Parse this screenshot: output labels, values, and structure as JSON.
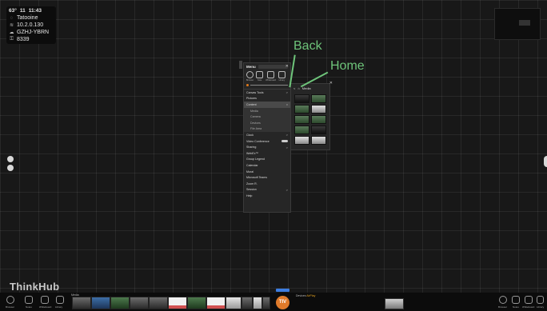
{
  "status": {
    "temperature": "63°",
    "date": "11",
    "time": "11:43",
    "location": "Tatooine",
    "ip": "10.2.0.130",
    "code": "GZHJ-YBRN",
    "pin": "8339"
  },
  "menu": {
    "title": "Menu",
    "icons": [
      {
        "name": "browser",
        "label": "Browser"
      },
      {
        "name": "note",
        "label": "Note"
      },
      {
        "name": "whiteboard",
        "label": "Whiteboard"
      },
      {
        "name": "library",
        "label": "Library"
      }
    ],
    "items": [
      {
        "label": "Canvas Tools",
        "chev": ">",
        "kind": "normal"
      },
      {
        "label": "Pictures",
        "chev": "",
        "kind": "normal"
      },
      {
        "label": "Content",
        "chev": "v",
        "kind": "selected"
      },
      {
        "label": "Media",
        "chev": "",
        "kind": "sub"
      },
      {
        "label": "Camera",
        "chev": "",
        "kind": "sub"
      },
      {
        "label": "Devices",
        "chev": "",
        "kind": "sub"
      },
      {
        "label": "File Area",
        "chev": "",
        "kind": "sub"
      },
      {
        "label": "Clock",
        "chev": ">",
        "kind": "normal"
      },
      {
        "label": "Video Conference",
        "chev": "toggle",
        "kind": "normal"
      },
      {
        "label": "Sharing",
        "chev": ">",
        "kind": "normal"
      },
      {
        "label": "WebEx™",
        "chev": "",
        "kind": "normal"
      },
      {
        "label": "Group Legend",
        "chev": "",
        "kind": "normal"
      },
      {
        "label": "Calendar",
        "chev": "",
        "kind": "normal"
      },
      {
        "label": "Mural",
        "chev": "",
        "kind": "normal"
      },
      {
        "label": "Microsoft Teams",
        "chev": "",
        "kind": "normal"
      },
      {
        "label": "Zoom R.",
        "chev": "",
        "kind": "normal"
      },
      {
        "label": "Session",
        "chev": ">",
        "kind": "normal"
      },
      {
        "label": "Help",
        "chev": "",
        "kind": "normal"
      }
    ]
  },
  "content_panel": {
    "title": "Media",
    "back": "<",
    "home": "⌂"
  },
  "annotations": {
    "back": "Back",
    "home": "Home"
  },
  "brand": "ThinkHub",
  "bottom": {
    "media_label": "Media",
    "tiv": "TIV",
    "devices_label": "Devices",
    "devices_badge": "AirPlay",
    "left_icons": [
      {
        "name": "browser",
        "label": "Browser"
      },
      {
        "name": "notes",
        "label": "Notes"
      },
      {
        "name": "whiteboard",
        "label": "Whiteboard"
      },
      {
        "name": "library",
        "label": "Library"
      }
    ],
    "right_icons": [
      {
        "name": "browser",
        "label": "Browser"
      },
      {
        "name": "notes",
        "label": "Notes"
      },
      {
        "name": "whiteboard",
        "label": "Whiteboard"
      },
      {
        "name": "library",
        "label": "Library"
      }
    ]
  },
  "colors": {
    "accent": "#e07a2a",
    "annotation": "#6ec47a",
    "canvas": "#181818"
  }
}
